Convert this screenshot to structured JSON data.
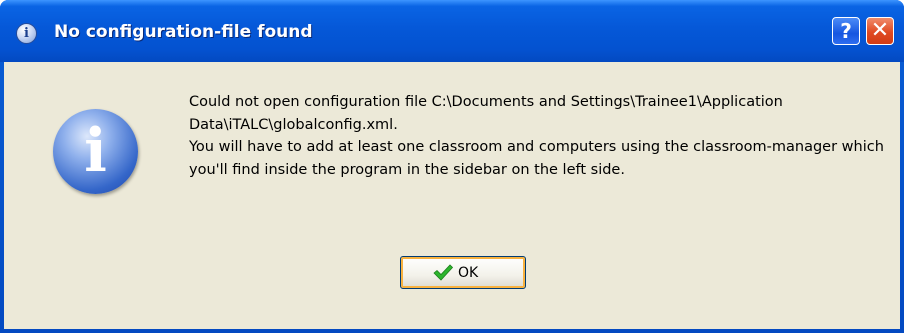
{
  "window": {
    "title": "No configuration-file found",
    "title_icon": "info-icon",
    "help_label": "?",
    "close_label": "✕"
  },
  "dialog": {
    "icon": "info-icon",
    "message_line1": "Could not open configuration file C:\\Documents and Settings\\Trainee1\\Application Data\\iTALC\\globalconfig.xml.",
    "message_line2": "You will have to add at least one classroom and computers using the classroom-manager which you'll find inside the program in the sidebar on the left side.",
    "ok_label": "OK",
    "ok_icon": "check-icon"
  },
  "colors": {
    "titlebar": "#0558d8",
    "client_bg": "#ece9d8",
    "close_red": "#e04a22",
    "check_green": "#2db52d"
  }
}
